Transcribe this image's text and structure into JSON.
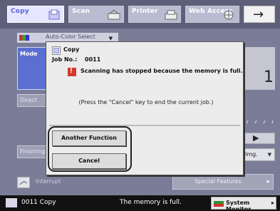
{
  "tabs": [
    {
      "label": "Copy",
      "icon": "copy-icon",
      "active": true
    },
    {
      "label": "Scan",
      "icon": "scan-icon",
      "active": false
    },
    {
      "label": "Printer",
      "icon": "printer-icon",
      "active": false
    },
    {
      "label": "Web Access",
      "icon": "web-access-icon",
      "active": false
    }
  ],
  "next_icon": "→",
  "panel": {
    "color_select": "Auto-Color Select",
    "mode_label": "Mode",
    "direct_label": "Direct",
    "finishing_label": "Finishing",
    "right_number": "1",
    "image_dropdown": "Img.",
    "interrupt_label": "Interrupt",
    "special_features_label": "Special Features"
  },
  "dialog": {
    "title": "Copy",
    "job_no_label": "Job No.:",
    "job_no_value": "0011",
    "warning_symbol": "!",
    "message": "Scanning has stopped because the memory is full.",
    "hint": "(Press the \"Cancel\" key to end the current job.)",
    "buttons": {
      "another_function": "Another Function",
      "cancel": "Cancel"
    }
  },
  "status_bar": {
    "job": "0011   Copy",
    "message": "The memory is full.",
    "system_monitor": "System Monitor"
  },
  "colors": {
    "panel_bg": "#7b7d98",
    "dialog_bg": "#ececec",
    "warning": "#d23b2b",
    "active_tab": "#e6e6ff"
  }
}
